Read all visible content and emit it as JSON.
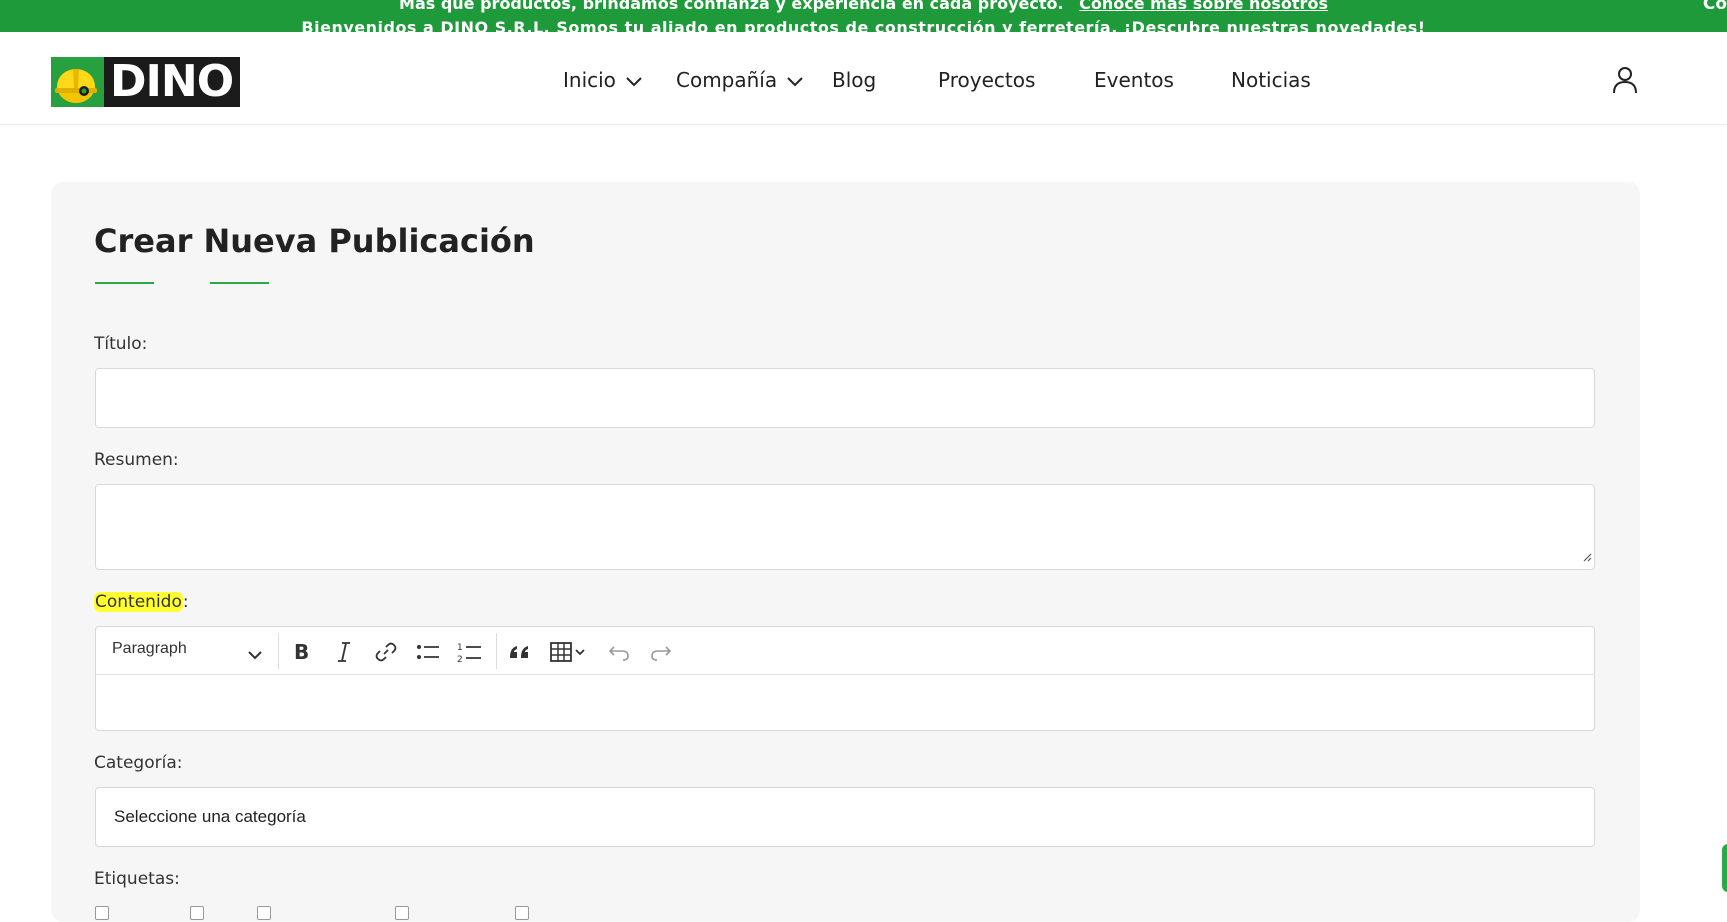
{
  "topbar": {
    "message": "Más que productos, brindamos confianza y experiencia en cada proyecto.",
    "link": "Conoce más sobre nosotros",
    "marquee": "Bienvenidos a DINO S.R.L. Somos tu aliado en productos de construcción y ferretería. ¡Descubre nuestras novedades!",
    "edge_text": "Co"
  },
  "header": {
    "logo_text": "DINO",
    "nav": [
      {
        "label": "Inicio",
        "has_dropdown": true
      },
      {
        "label": "Compañía",
        "has_dropdown": true
      },
      {
        "label": "Blog",
        "has_dropdown": false
      },
      {
        "label": "Proyectos",
        "has_dropdown": false
      },
      {
        "label": "Eventos",
        "has_dropdown": false
      },
      {
        "label": "Noticias",
        "has_dropdown": false
      }
    ],
    "user_icon": "user-icon"
  },
  "form": {
    "title": "Crear Nueva Publicación",
    "titulo_label": "Título:",
    "titulo_value": "",
    "resumen_label": "Resumen:",
    "resumen_value": "",
    "contenido_label_highlight": "Contenido",
    "contenido_label_rest": ":",
    "editor": {
      "paragraph_select": "Paragraph",
      "tools": [
        "bold-icon",
        "italic-icon",
        "link-icon",
        "bulleted-list-icon",
        "numbered-list-icon",
        "blockquote-icon",
        "table-icon",
        "undo-icon",
        "redo-icon"
      ]
    },
    "categoria_label": "Categoría:",
    "categoria_value": "Seleccione una categoría",
    "etiquetas_label": "Etiquetas:"
  },
  "colors": {
    "brand_green": "#1e9a3a",
    "accent_green": "#2aa84a",
    "highlight": "#ffff33"
  }
}
